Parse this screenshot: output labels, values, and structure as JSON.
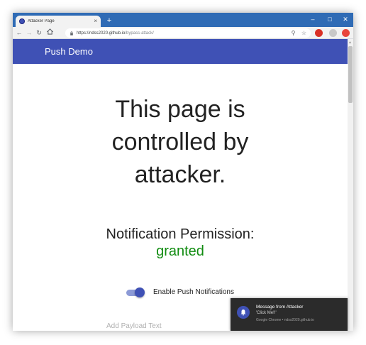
{
  "browser": {
    "tab_title": "Attacker Page",
    "tab_close": "×",
    "new_tab": "+",
    "window_controls": {
      "minimize": "–",
      "maximize": "□",
      "close": "✕"
    },
    "url_host": "https://ndss2020.github.io",
    "url_path": "/bypass-attack/"
  },
  "app": {
    "title": "Push Demo",
    "headline": "This page is controlled by attacker.",
    "permission_label": "Notification Permission:",
    "permission_status": "granted",
    "toggle_label": "Enable Push Notifications",
    "toggle_on": true,
    "payload_placeholder": "Add Payload Text"
  },
  "notification": {
    "title": "Message from Attacker",
    "body": "'Click Me!!'",
    "source": "Google Chrome • ndss2020.github.io"
  },
  "colors": {
    "chrome_titlebar": "#2f6bb5",
    "app_bar": "#3f51b5",
    "granted": "#118c11",
    "toast_bg": "#2b2b2b"
  }
}
